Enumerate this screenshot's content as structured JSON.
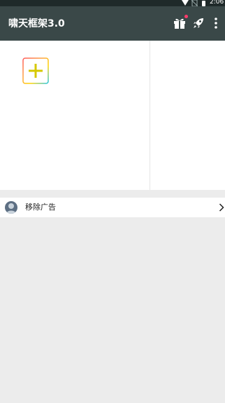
{
  "status_bar": {
    "time": "2:06",
    "icons": [
      "wifi-signal-icon",
      "no-sim-icon",
      "battery-icon"
    ]
  },
  "app_bar": {
    "title": "啸天框架3.0",
    "actions": [
      "gift-icon",
      "rocket-icon",
      "overflow-menu-icon"
    ],
    "badge_color": "#ff3b6b",
    "background": "#3a4848"
  },
  "grid": {
    "items": [
      {
        "type": "add-button",
        "icon": "plus-icon"
      }
    ]
  },
  "ad_row": {
    "label": "移除广告",
    "icon": "avatar-icon",
    "trailing_icon": "chevron-right-icon"
  }
}
